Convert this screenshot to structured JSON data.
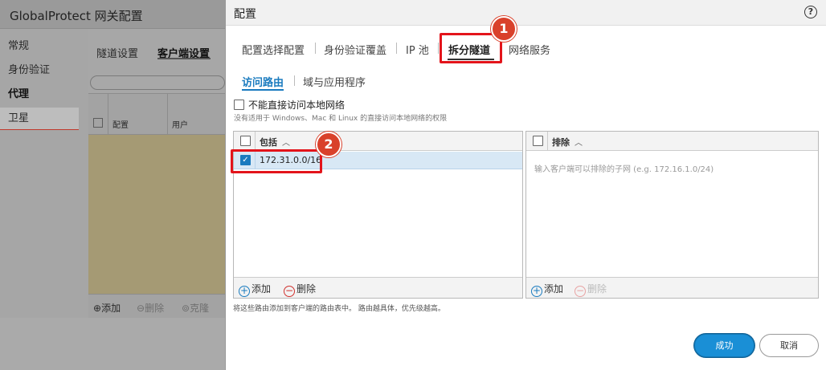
{
  "background": {
    "window_title": "GlobalProtect 网关配置",
    "sidebar": [
      "常规",
      "身份验证",
      "代理",
      "卫星"
    ],
    "tabs": [
      "隧道设置",
      "客户端设置"
    ],
    "table_headers": [
      "配置",
      "用户"
    ],
    "footer_buttons": [
      "添加",
      "删除",
      "克隆"
    ]
  },
  "dialog": {
    "title": "配置",
    "help_icon": "question-circle-icon",
    "tabs": [
      {
        "label": "配置选择配置"
      },
      {
        "label": "身份验证覆盖"
      },
      {
        "label": "IP 池"
      },
      {
        "label": "拆分隧道",
        "active": true
      },
      {
        "label": "网络服务"
      }
    ],
    "subtabs": [
      {
        "label": "访问路由",
        "active": true
      },
      {
        "label": "域与应用程序"
      }
    ],
    "no_local_access": {
      "label": "不能直接访问本地网络",
      "checked": false,
      "hint": "没有适用于 Windows、Mac 和 Linux 的直接访问本地网络的权限"
    },
    "include": {
      "header": "包括",
      "routes": [
        {
          "value": "172.31.0.0/16",
          "checked": true
        }
      ],
      "add_label": "添加",
      "delete_label": "删除"
    },
    "exclude": {
      "header": "排除",
      "placeholder": "输入客户端可以排除的子网 (e.g. 172.16.1.0/24)",
      "add_label": "添加",
      "delete_label": "删除"
    },
    "note": "将这些路由添加到客户端的路由表中。 路由越具体，优先级越高。",
    "ok_label": "成功",
    "cancel_label": "取消"
  },
  "annotations": {
    "badge_1": "1",
    "badge_2": "2",
    "color": "#e3141b"
  }
}
